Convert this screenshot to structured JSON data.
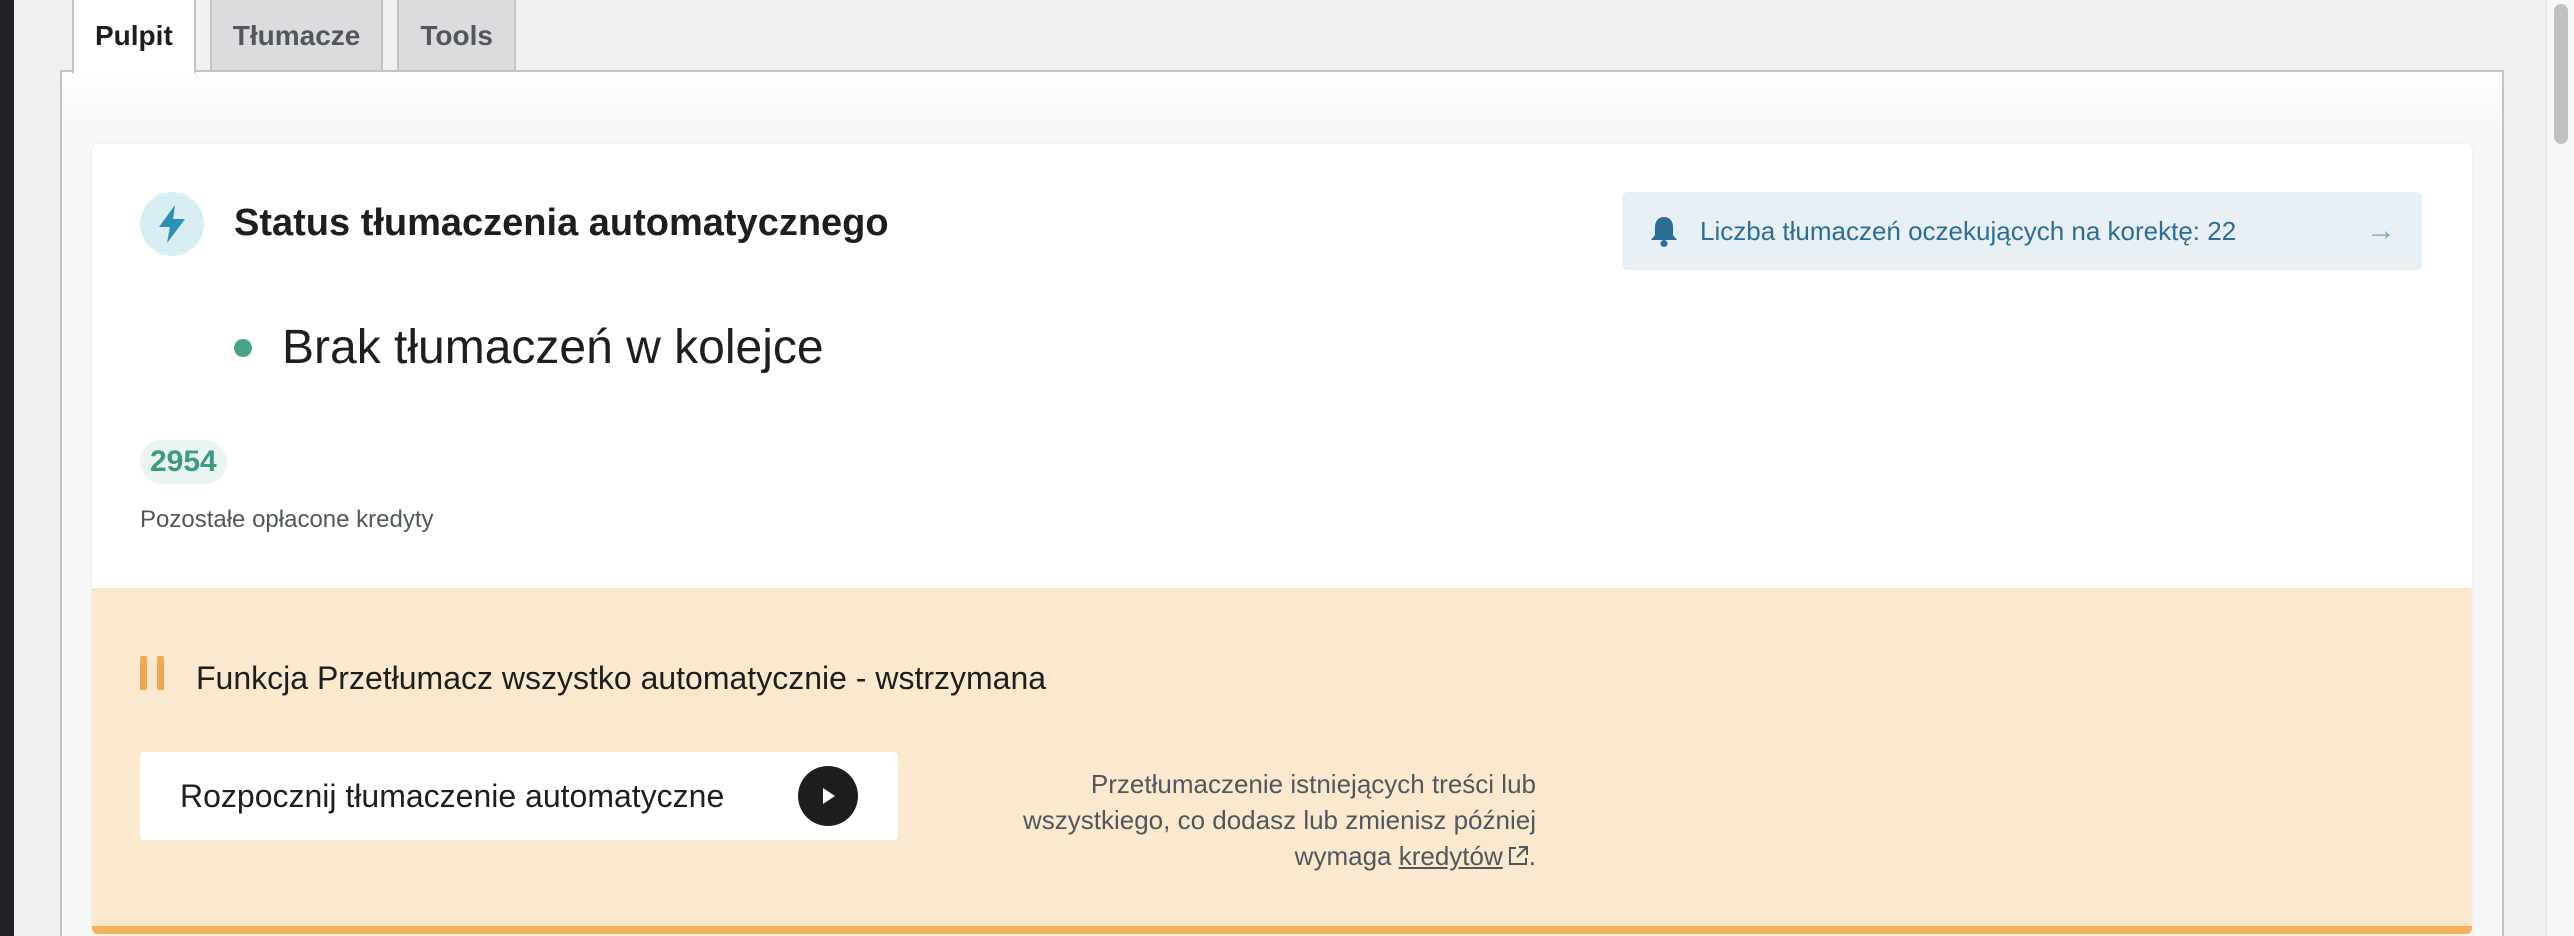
{
  "tabs": [
    {
      "label": "Pulpit",
      "active": true
    },
    {
      "label": "Tłumacze",
      "active": false
    },
    {
      "label": "Tools",
      "active": false
    }
  ],
  "status": {
    "title": "Status tłumaczenia automatycznego",
    "icon": "lightning-icon",
    "queue_text": "Brak tłumaczeń w kolejce",
    "queue_status_color": "#48a38d"
  },
  "notice": {
    "icon": "bell-icon",
    "text": "Liczba tłumaczeń oczekujących na korektę: 22",
    "arrow_icon": "arrow-right-icon"
  },
  "credits": {
    "value": "2954",
    "label": "Pozostałe opłacone kredyty"
  },
  "paused_section": {
    "title": "Funkcja Przetłumacz wszystko automatycznie - wstrzymana",
    "icon": "pause-icon",
    "start_button_label": "Rozpocznij tłumaczenie automatyczne",
    "start_icon": "play-icon",
    "description_line1": "Przetłumaczenie istniejących treści lub",
    "description_line2": "wszystkiego, co dodasz lub zmienisz później",
    "description_prefix": "wymaga ",
    "description_link": "kredytów",
    "description_suffix": ".",
    "accent_color": "#f5b25a",
    "background_color": "#fbe9cf"
  }
}
